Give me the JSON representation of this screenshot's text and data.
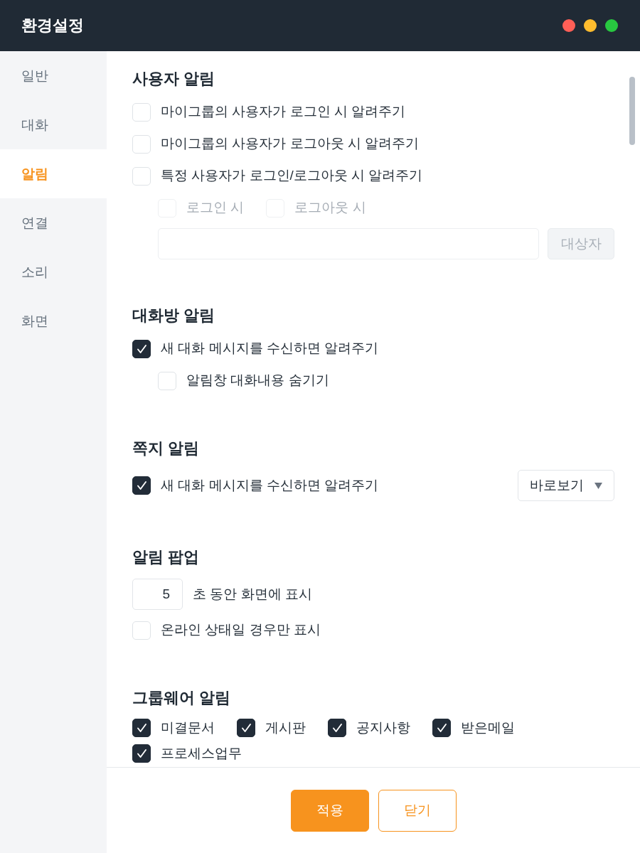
{
  "window": {
    "title": "환경설정",
    "controls": [
      {
        "color": "#ff5f57"
      },
      {
        "color": "#febc2e"
      },
      {
        "color": "#28c840"
      }
    ]
  },
  "sidebar": {
    "items": [
      {
        "label": "일반",
        "selected": false
      },
      {
        "label": "대화",
        "selected": false
      },
      {
        "label": "알림",
        "selected": true
      },
      {
        "label": "연결",
        "selected": false
      },
      {
        "label": "소리",
        "selected": false
      },
      {
        "label": "화면",
        "selected": false
      }
    ]
  },
  "sections": [
    {
      "title": "사용자 알림",
      "rows": [
        {
          "kind": "checkbox",
          "label": "마이그룹의 사용자가 로그인 시 알려주기",
          "checked": false
        },
        {
          "kind": "checkbox",
          "label": "마이그룹의 사용자가 로그아웃 시 알려주기",
          "checked": false
        },
        {
          "kind": "checkbox",
          "label": "특정 사용자가 로그인/로그아웃 시 알려주기",
          "checked": false,
          "children": [
            {
              "kind": "checkbox_group",
              "options": [
                {
                  "label": "로그인 시",
                  "checked": false,
                  "disabled": true
                },
                {
                  "label": "로그아웃 시",
                  "checked": false,
                  "disabled": true
                }
              ]
            },
            {
              "kind": "picker",
              "field": {
                "disabled": true
              },
              "button": {
                "label": "대상자",
                "disabled": true
              }
            }
          ]
        }
      ]
    },
    {
      "title": "대화방 알림",
      "rows": [
        {
          "kind": "checkbox",
          "label": "새 대화 메시지를 수신하면 알려주기",
          "checked": true,
          "children": [
            {
              "kind": "checkbox",
              "label": "알림창 대화내용 숨기기",
              "checked": false,
              "disabled": false
            }
          ]
        }
      ]
    },
    {
      "title": "쪽지 알림",
      "rows": [
        {
          "kind": "checkbox_select",
          "label": "새 대화 메시지를 수신하면 알려주기",
          "checked": true,
          "select": {
            "value": "바로보기"
          }
        }
      ]
    },
    {
      "title": "알림 팝업",
      "rows": [
        {
          "kind": "number",
          "value": "5",
          "label": "초 동안 화면에 표시"
        },
        {
          "kind": "checkbox",
          "label": "온라인 상태일 경우만 표시",
          "checked": false
        }
      ]
    },
    {
      "title": "그룹웨어 알림",
      "rows": [
        {
          "kind": "checkbox_group",
          "options": [
            {
              "label": "미결문서",
              "checked": true
            },
            {
              "label": "게시판",
              "checked": true
            },
            {
              "label": "공지사항",
              "checked": true
            },
            {
              "label": "받은메일",
              "checked": true
            },
            {
              "label": "프로세스업무",
              "checked": true
            }
          ]
        }
      ]
    }
  ],
  "footer": {
    "buttons": [
      {
        "label": "적용",
        "kind": "primary"
      },
      {
        "label": "닫기",
        "kind": "secondary"
      }
    ]
  }
}
